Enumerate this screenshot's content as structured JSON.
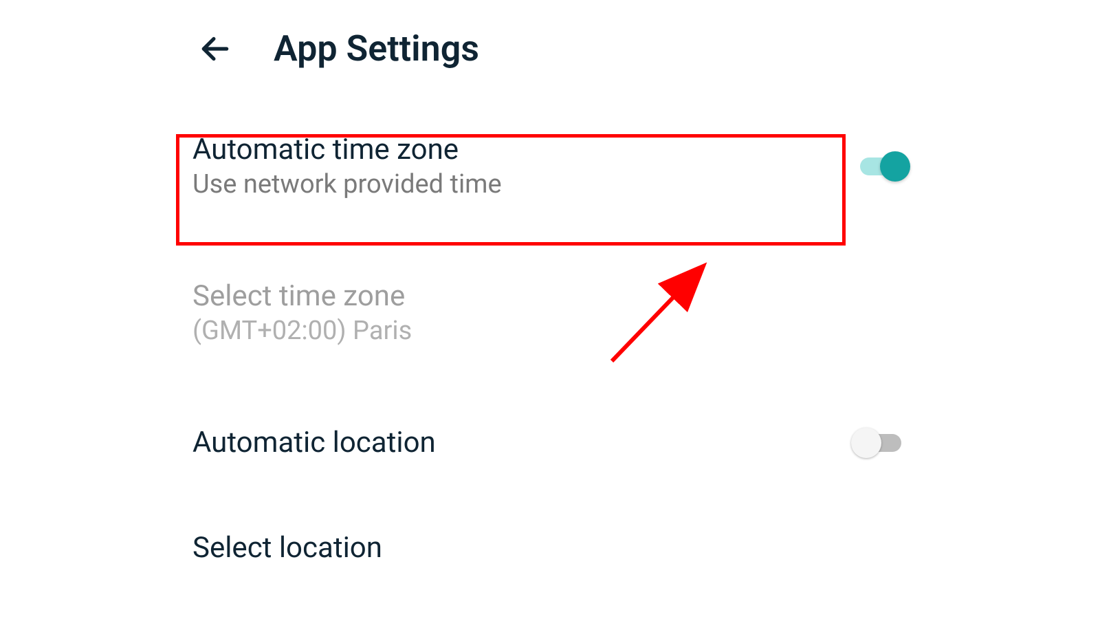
{
  "header": {
    "title": "App Settings"
  },
  "settings": {
    "auto_timezone": {
      "title": "Automatic time zone",
      "subtitle": "Use network provided time",
      "toggle_state": "on"
    },
    "select_timezone": {
      "title": "Select time zone",
      "subtitle": "(GMT+02:00) Paris",
      "enabled": false
    },
    "auto_location": {
      "title": "Automatic location",
      "toggle_state": "off"
    },
    "select_location": {
      "title": "Select location"
    }
  },
  "annotation": {
    "highlight_color": "#ff0000",
    "arrow_color": "#ff0000"
  }
}
